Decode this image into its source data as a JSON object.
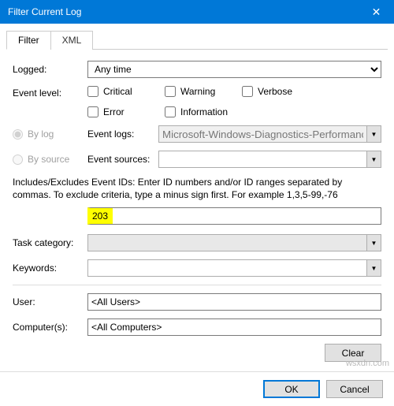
{
  "window": {
    "title": "Filter Current Log"
  },
  "tabs": {
    "filter": "Filter",
    "xml": "XML"
  },
  "labels": {
    "logged": "Logged:",
    "eventLevel": "Event level:",
    "byLog": "By log",
    "bySource": "By source",
    "eventLogs": "Event logs:",
    "eventSources": "Event sources:",
    "taskCategory": "Task category:",
    "keywords": "Keywords:",
    "user": "User:",
    "computers": "Computer(s):"
  },
  "logged": {
    "selected": "Any time"
  },
  "levels": {
    "critical": "Critical",
    "warning": "Warning",
    "verbose": "Verbose",
    "error": "Error",
    "information": "Information"
  },
  "eventLogs": {
    "value": "Microsoft-Windows-Diagnostics-Performance"
  },
  "eventSources": {
    "value": ""
  },
  "description": "Includes/Excludes Event IDs: Enter ID numbers and/or ID ranges separated by commas. To exclude criteria, type a minus sign first. For example 1,3,5-99,-76",
  "eventIds": {
    "value": "203"
  },
  "user": {
    "value": "<All Users>"
  },
  "computers": {
    "value": "<All Computers>"
  },
  "buttons": {
    "clear": "Clear",
    "ok": "OK",
    "cancel": "Cancel"
  },
  "watermark": "wsxdn.com"
}
